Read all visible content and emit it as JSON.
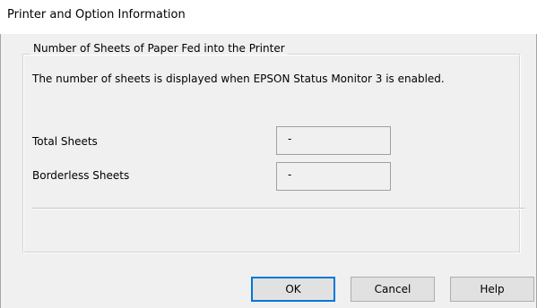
{
  "window": {
    "title": "Printer and Option Information"
  },
  "group": {
    "legend": "Number of Sheets of Paper Fed into the Printer",
    "description": "The number of sheets is displayed when EPSON Status Monitor 3 is enabled."
  },
  "fields": {
    "total_sheets": {
      "label": "Total Sheets",
      "value": "-"
    },
    "borderless_sheets": {
      "label": "Borderless Sheets",
      "value": "-"
    }
  },
  "buttons": {
    "ok": "OK",
    "cancel": "Cancel",
    "help": "Help"
  }
}
